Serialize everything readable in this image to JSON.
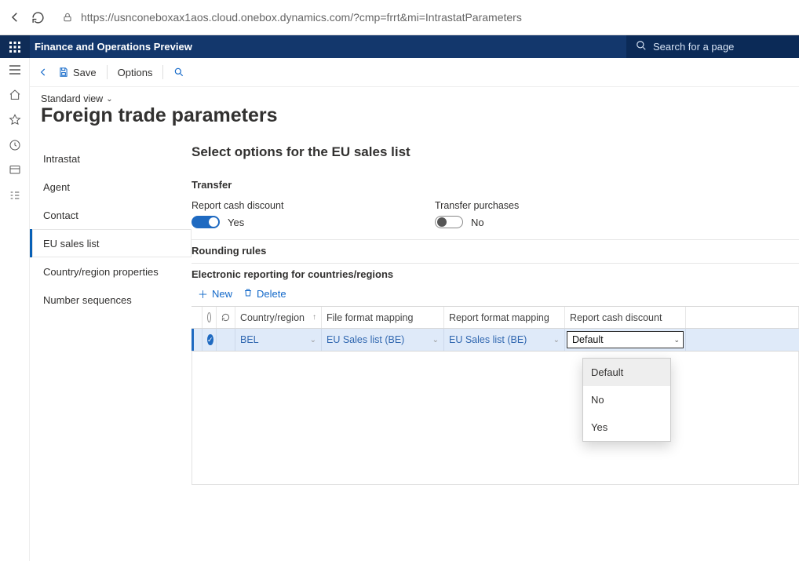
{
  "browser": {
    "url": "https://usnconeboxax1aos.cloud.onebox.dynamics.com/?cmp=frrt&mi=IntrastatParameters"
  },
  "app": {
    "title": "Finance and Operations Preview",
    "search_placeholder": "Search for a page"
  },
  "actionbar": {
    "save": "Save",
    "options": "Options"
  },
  "page": {
    "view_label": "Standard view",
    "title": "Foreign trade parameters"
  },
  "sidenav": {
    "items": [
      "Intrastat",
      "Agent",
      "Contact",
      "EU sales list",
      "Country/region properties",
      "Number sequences"
    ],
    "active_index": 3
  },
  "detail": {
    "heading": "Select options for the EU sales list",
    "transfer": {
      "section": "Transfer",
      "report_cash_discount_label": "Report cash discount",
      "report_cash_discount_value": "Yes",
      "report_cash_discount_on": true,
      "transfer_purchases_label": "Transfer purchases",
      "transfer_purchases_value": "No",
      "transfer_purchases_on": false
    },
    "rounding": {
      "section": "Rounding rules"
    },
    "er": {
      "section": "Electronic reporting for countries/regions",
      "new_label": "New",
      "delete_label": "Delete",
      "columns": {
        "country": "Country/region",
        "file_format": "File format mapping",
        "report_format": "Report format mapping",
        "report_cash_discount": "Report cash discount"
      },
      "row": {
        "country": "BEL",
        "file_format": "EU Sales list (BE)",
        "report_format": "EU Sales list (BE)",
        "report_cash_discount": "Default"
      },
      "dropdown_options": [
        "Default",
        "No",
        "Yes"
      ]
    }
  }
}
